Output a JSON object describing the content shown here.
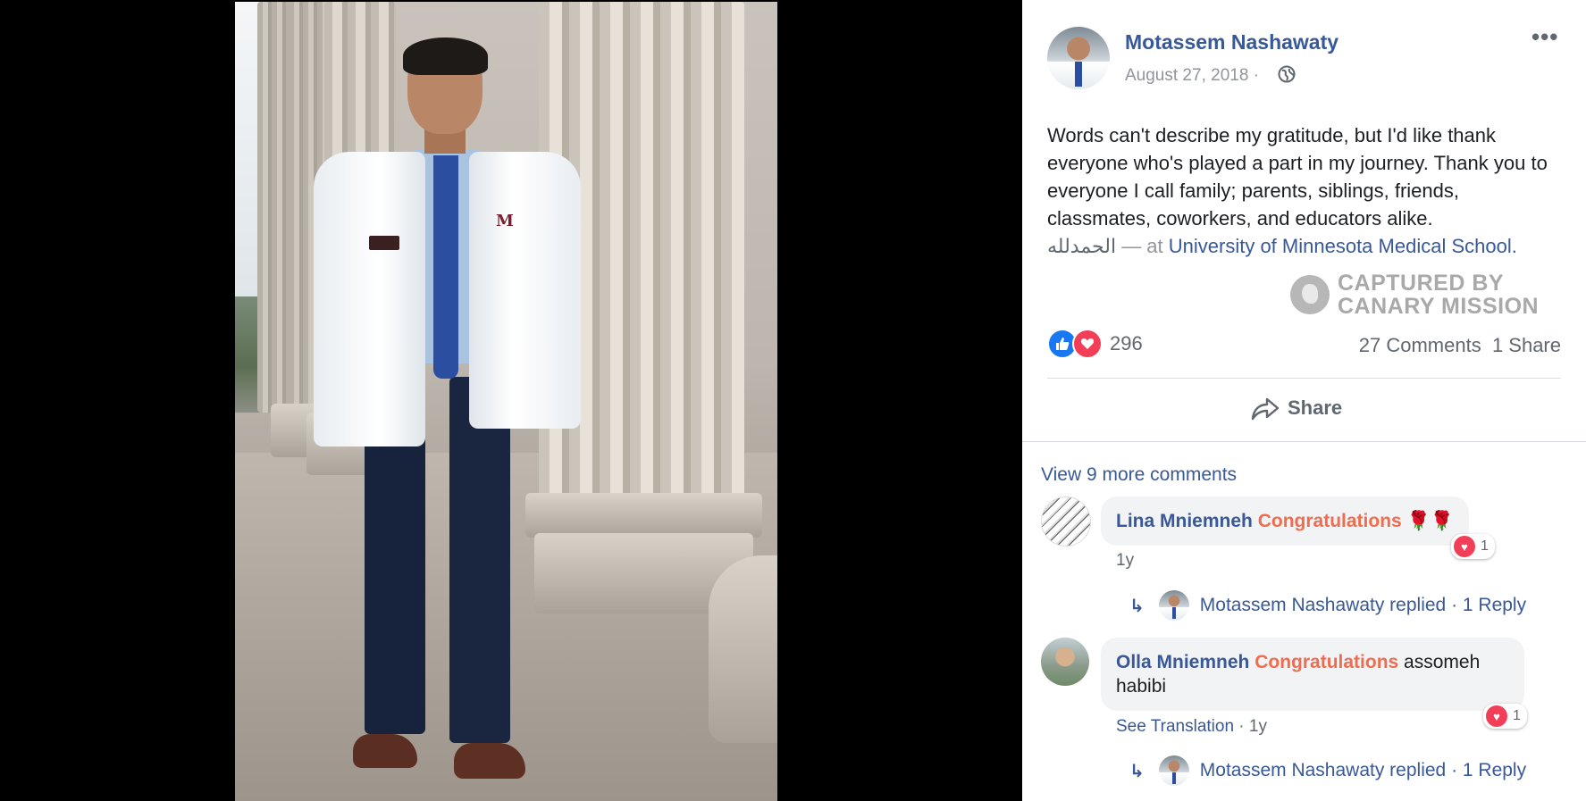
{
  "post": {
    "author": "Motassem Nashawaty",
    "date": "August 27, 2018",
    "privacy_sep": "·",
    "more_label": "•••",
    "text_main": "Words can't describe my gratitude, but I'd like thank everyone who's played a part in my journey. Thank you to everyone I call family; parents, siblings, friends, classmates, coworkers, and educators alike.",
    "text_arabic": "الحمدلله",
    "text_at": " — at ",
    "location": "University of Minnesota Medical School",
    "location_end": ".",
    "watermark_line1": "CAPTURED BY",
    "watermark_line2": "CANARY MISSION"
  },
  "reactions": {
    "count": "296",
    "comments_label": "27 Comments",
    "shares_label": "1 Share",
    "share_button": "Share"
  },
  "comments": {
    "view_more": "View 9 more comments",
    "items": [
      {
        "author": "Lina Mniemneh",
        "highlight": "Congratulations",
        "rest": "",
        "emoji": "🌹🌹",
        "reaction_count": "1",
        "meta": "1y",
        "reply": "Motassem Nashawaty replied",
        "reply_count": "· 1 Reply"
      },
      {
        "author": "Olla Mniemneh",
        "highlight": "Congratulations",
        "rest": " assomeh habibi",
        "emoji": "",
        "reaction_count": "1",
        "meta_link": "See Translation",
        "meta": " · 1y",
        "reply": "Motassem Nashawaty replied",
        "reply_count": "· 1 Reply"
      }
    ]
  },
  "colors": {
    "link": "#385898",
    "highlight": "#f06c4f",
    "like": "#1877f2",
    "love": "#f33e58"
  },
  "icons": [
    "globe-icon",
    "like-icon",
    "love-icon",
    "share-arrow-icon",
    "reply-arrow-icon",
    "more-icon"
  ]
}
